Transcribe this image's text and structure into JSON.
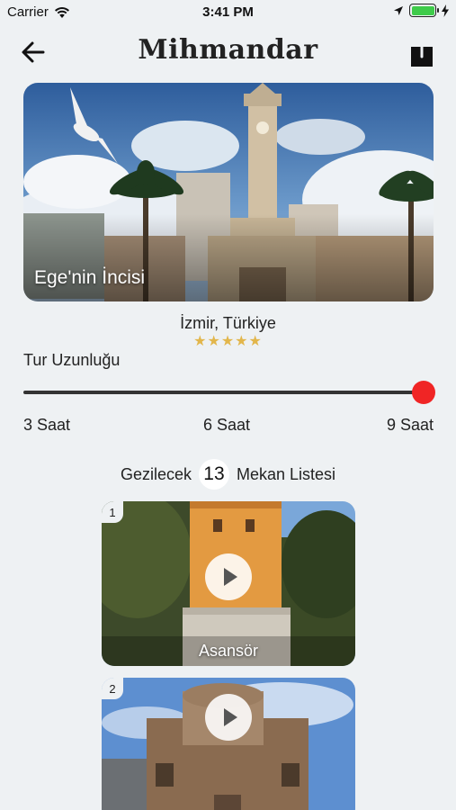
{
  "status_bar": {
    "carrier": "Carrier",
    "time": "3:41 PM",
    "icons": [
      "wifi-icon",
      "location-arrow-icon",
      "battery-icon",
      "charging-bolt-icon"
    ]
  },
  "nav": {
    "title": "Mihmandar",
    "back_icon": "arrow-left-icon",
    "share_icon": "share-icon"
  },
  "hero": {
    "caption": "Ege'nin İncisi",
    "city": "İzmir, Türkiye",
    "rating": 5,
    "stars": "★★★★★"
  },
  "tour": {
    "label": "Tur Uzunluğu",
    "min_label": "3 Saat",
    "mid_label": "6 Saat",
    "max_label": "9 Saat",
    "value_fraction": 1.0
  },
  "places": {
    "prefix": "Gezilecek",
    "count": "13",
    "suffix": "Mekan Listesi",
    "items": [
      {
        "index": "1",
        "name": "Asansör"
      },
      {
        "index": "2",
        "name": ""
      }
    ]
  },
  "colors": {
    "background": "#eef1f3",
    "slider_thumb": "#f02525",
    "star": "#e2b64b",
    "battery": "#3ecb4a"
  }
}
